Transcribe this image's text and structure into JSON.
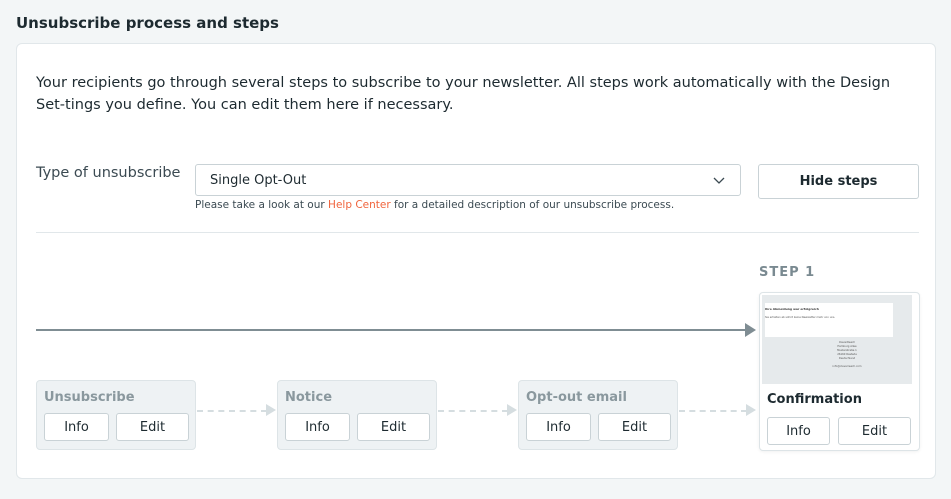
{
  "section_title": "Unsubscribe process and steps",
  "intro": "Your recipients go through several steps to subscribe to your newsletter. All steps work automatically with the Design Set-tings you define. You can edit them here if necessary.",
  "type_label": "Type of unsubscribe",
  "select": {
    "value": "Single Opt-Out"
  },
  "help": {
    "before": "Please take a look at our ",
    "link": "Help Center",
    "after": " for a detailed description of our unsubscribe process."
  },
  "hide_steps_label": "Hide steps",
  "step_label": "STEP 1",
  "steps": [
    {
      "title": "Unsubscribe",
      "info": "Info",
      "edit": "Edit"
    },
    {
      "title": "Notice",
      "info": "Info",
      "edit": "Edit"
    },
    {
      "title": "Opt-out email",
      "info": "Info",
      "edit": "Edit"
    }
  ],
  "confirmation": {
    "title": "Confirmation",
    "info": "Info",
    "edit": "Edit",
    "preview": {
      "heading": "Ihre Abmeldung war erfolgreich",
      "body": "Sie erhalten ab sofort keine Newsletter mehr von uns.",
      "address": [
        "CleverReach",
        "Hamburg Allee",
        "Musterstraße 1",
        "26160 Rastede",
        "Deutschland",
        "",
        "info@cleverreach.com"
      ]
    }
  },
  "colors": {
    "accent_link": "#f0643c",
    "text": "#1d2a30",
    "muted": "#8a989e",
    "background": "#f3f6f7"
  },
  "icons": {
    "select_chevron": "chevron-down-icon"
  }
}
